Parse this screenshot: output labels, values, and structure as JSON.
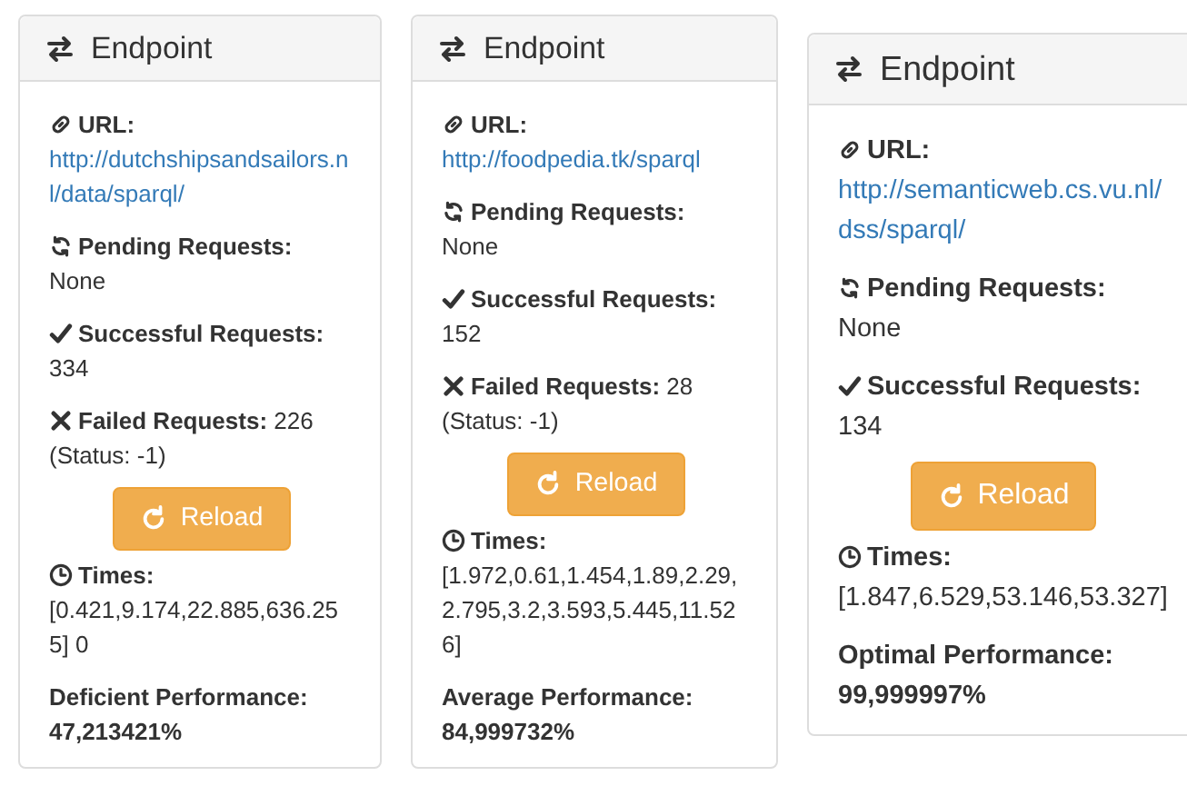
{
  "cards": [
    {
      "title": "Endpoint",
      "url_label": "URL:",
      "url": "http://dutchshipsandsailors.nl/data/sparql/",
      "pending_label": "Pending Requests:",
      "pending": "None",
      "success_label": "Successful Requests:",
      "success": "334",
      "failed_label": "Failed Requests:",
      "failed": "226",
      "status": "(Status: -1)",
      "button": "Reload",
      "times_label": "Times:",
      "times": "[0.421,9.174,22.885,636.255] 0",
      "performance_label": "Deficient Performance:",
      "performance": "47,213421%"
    },
    {
      "title": "Endpoint",
      "url_label": "URL:",
      "url": "http://foodpedia.tk/sparql",
      "pending_label": "Pending Requests:",
      "pending": "None",
      "success_label": "Successful Requests:",
      "success": "152",
      "failed_label": "Failed Requests:",
      "failed": "28",
      "status": "(Status: -1)",
      "button": "Reload",
      "times_label": "Times:",
      "times": "[1.972,0.61,1.454,1.89,2.29,2.795,3.2,3.593,5.445,11.526]",
      "performance_label": "Average Performance:",
      "performance": "84,999732%"
    },
    {
      "title": "Endpoint",
      "url_label": "URL:",
      "url": "http://semanticweb.cs.vu.nl/dss/sparql/",
      "pending_label": "Pending Requests:",
      "pending": "None",
      "success_label": "Successful Requests:",
      "success": "134",
      "button": "Reload",
      "times_label": "Times:",
      "times": "[1.847,6.529,53.146,53.327]",
      "performance_label": "Optimal Performance:",
      "performance": "99,999997%"
    }
  ]
}
